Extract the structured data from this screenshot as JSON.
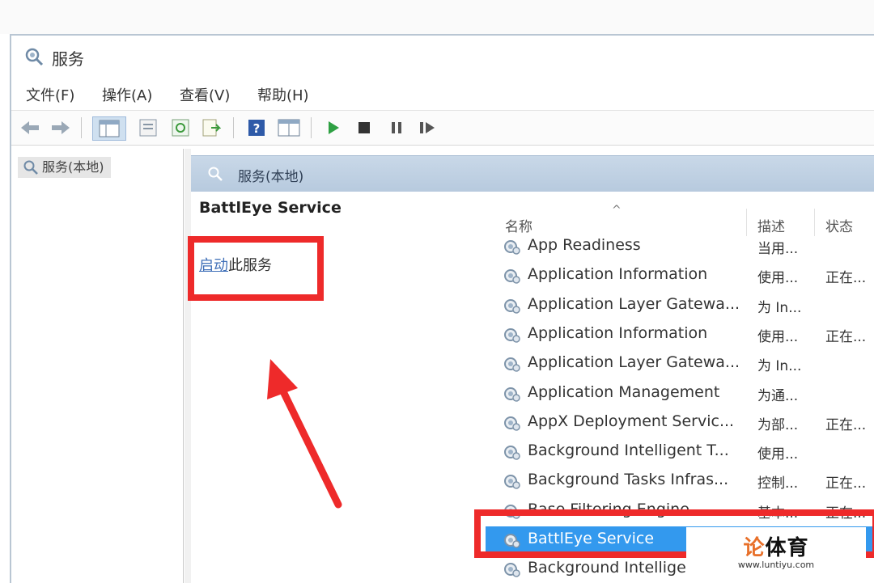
{
  "window": {
    "title": "服务"
  },
  "menu": [
    "文件(F)",
    "操作(A)",
    "查看(V)",
    "帮助(H)"
  ],
  "toolbar": {
    "icons": [
      "back-icon",
      "forward-icon",
      "console-tree-icon",
      "properties-icon",
      "refresh-icon",
      "export-icon",
      "help-icon",
      "view-icon",
      "play-icon",
      "stop-icon",
      "pause-icon",
      "resume-icon"
    ]
  },
  "tree": {
    "item": "服务(本地)"
  },
  "pane": {
    "header": "服务(本地)",
    "detail_title": "BattlEye Service",
    "link_text": "启动",
    "link_suffix": "此服务"
  },
  "list": {
    "columns": {
      "name": "名称",
      "desc": "描述",
      "status": "状态"
    },
    "rows": [
      {
        "name": "App Readiness",
        "desc": "当用...",
        "status": ""
      },
      {
        "name": "Application Information",
        "desc": "使用...",
        "status": "正在..."
      },
      {
        "name": "Application Layer Gatewa...",
        "desc": "为 In...",
        "status": ""
      },
      {
        "name": "Application Information",
        "desc": "使用...",
        "status": "正在..."
      },
      {
        "name": "Application Layer Gatewa...",
        "desc": "为 In...",
        "status": ""
      },
      {
        "name": "Application Management",
        "desc": "为通...",
        "status": ""
      },
      {
        "name": "AppX Deployment Servic...",
        "desc": "为部...",
        "status": "正在..."
      },
      {
        "name": "Background Intelligent T...",
        "desc": "使用...",
        "status": ""
      },
      {
        "name": "Background Tasks Infras...",
        "desc": "控制...",
        "status": "正在..."
      },
      {
        "name": "Base Filtering Engine",
        "desc": "基本...",
        "status": "正在..."
      },
      {
        "name": "BattlEye Service",
        "desc": "",
        "status": ""
      },
      {
        "name": "Background Intelligent",
        "desc": "",
        "status": ""
      }
    ],
    "selected_index": 10
  },
  "watermark": {
    "brand_a": "论",
    "brand_b": "体育",
    "url": "www.luntiyu.com"
  },
  "colors": {
    "annotation_red": "#ee2a2a",
    "selection_blue": "#3399ee",
    "header_blue": "#c0d2e4"
  }
}
